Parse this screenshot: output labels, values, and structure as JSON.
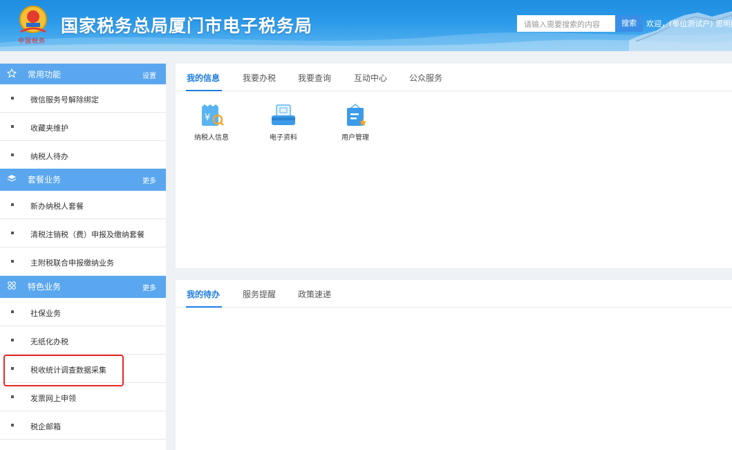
{
  "header": {
    "site_title": "国家税务总局厦门市电子税务局",
    "brand_sub": "中国税务",
    "search_placeholder": "请输入需要搜索的内容",
    "search_button": "搜索",
    "welcome": "欢迎，(单位测试户) 思明区"
  },
  "sidebar": {
    "sections": [
      {
        "title": "常用功能",
        "action": "设置",
        "icon": "star-icon",
        "items": [
          "微信服务号解除绑定",
          "收藏夹维护",
          "纳税人待办"
        ]
      },
      {
        "title": "套餐业务",
        "action": "更多",
        "icon": "layers-icon",
        "items": [
          "新办纳税人套餐",
          "清税注销税（费）申报及缴纳套餐",
          "主附税联合申报缴纳业务"
        ]
      },
      {
        "title": "特色业务",
        "action": "更多",
        "icon": "grid-icon",
        "items": [
          "社保业务",
          "无纸化办税",
          "税收统计调查数据采集",
          "发票网上申领",
          "税企邮箱"
        ]
      }
    ]
  },
  "main_top": {
    "tabs": [
      "我的信息",
      "我要办税",
      "我要查询",
      "互动中心",
      "公众服务"
    ],
    "apps": [
      "纳税人信息",
      "电子资料",
      "用户管理"
    ]
  },
  "main_bottom": {
    "tabs": [
      "我的待办",
      "服务提醒",
      "政策速递"
    ]
  },
  "colors": {
    "accent": "#1e7ce0",
    "section_header": "#5aa7ef",
    "highlight": "#e62626"
  }
}
